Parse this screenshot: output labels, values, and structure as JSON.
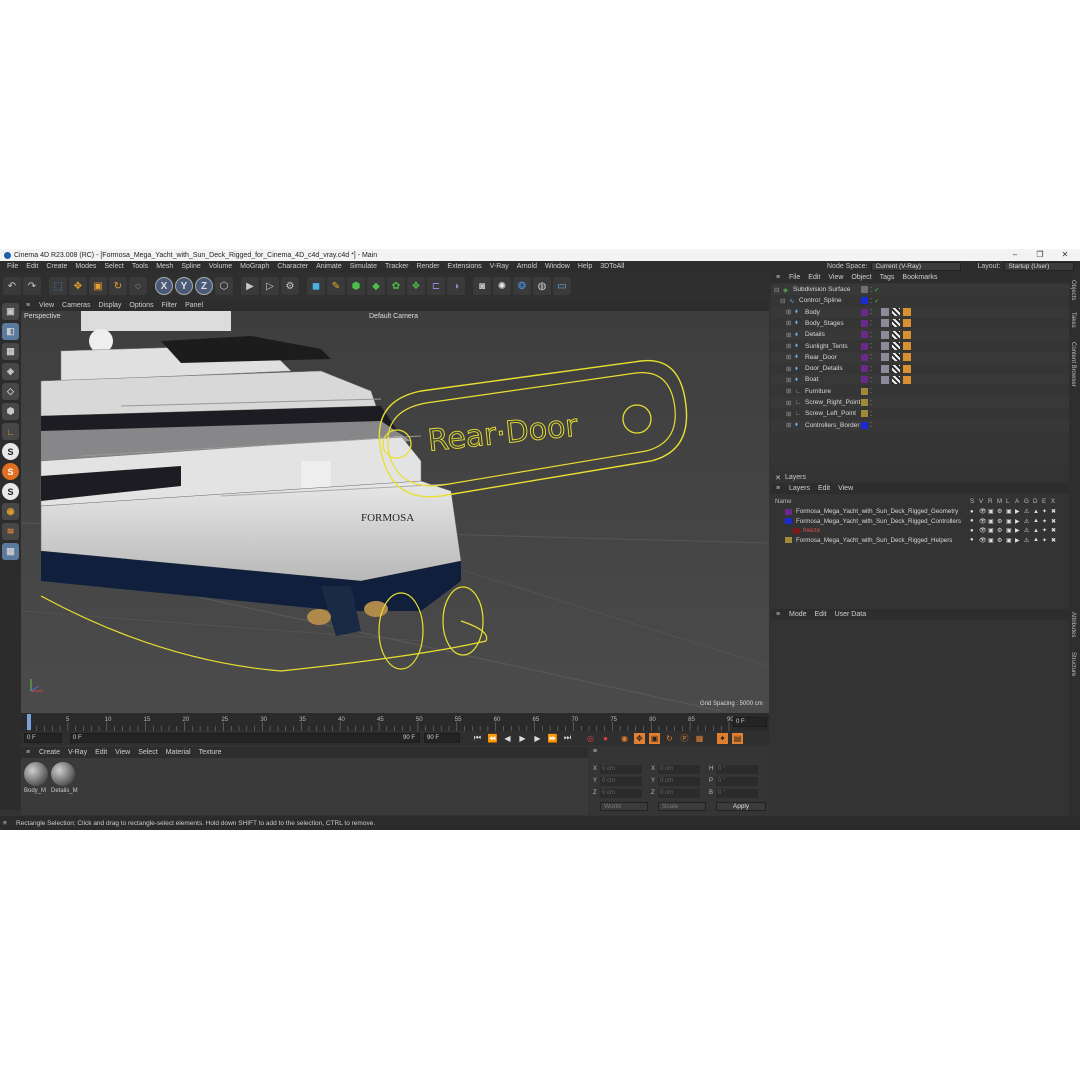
{
  "window": {
    "title": "Cinema 4D R23.008 (RC) - [Formosa_Mega_Yacht_with_Sun_Deck_Rigged_for_Cinema_4D_c4d_vray.c4d *] - Main",
    "minimize": "–",
    "maximize": "❐",
    "close": "✕"
  },
  "menubar": [
    "File",
    "Edit",
    "Create",
    "Modes",
    "Select",
    "Tools",
    "Mesh",
    "Spline",
    "Volume",
    "MoGraph",
    "Character",
    "Animate",
    "Simulate",
    "Tracker",
    "Render",
    "Extensions",
    "V-Ray",
    "Arnold",
    "Window",
    "Help",
    "3DToAll"
  ],
  "node_space": {
    "label": "Node Space:",
    "value": "Current (V-Ray)"
  },
  "layout": {
    "label": "Layout:",
    "value": "Startup (User)"
  },
  "toolbar_icons": [
    "undo-icon",
    "redo-icon",
    "live-selection-icon",
    "move-icon",
    "scale-icon",
    "rotate-icon",
    "recent-tool-icon",
    "x-axis-icon",
    "y-axis-icon",
    "z-axis-icon",
    "coordinate-system-icon",
    "render-view-icon",
    "render-picture-viewer-icon",
    "render-settings-icon",
    "cube-icon",
    "pen-icon",
    "subdivision-icon",
    "extrude-icon",
    "cloner-icon",
    "mograph-icon",
    "deformer-icon",
    "field-icon",
    "camera-icon",
    "light-icon",
    "python-icon",
    "sky-icon",
    "floor-icon"
  ],
  "toolbar_axes": [
    "X",
    "Y",
    "Z"
  ],
  "viewport": {
    "menu": [
      "View",
      "Cameras",
      "Display",
      "Options",
      "Filter",
      "Panel"
    ],
    "projection": "Perspective",
    "camera": "Default Camera",
    "grid_spacing": "Grid Spacing : 5000 cm",
    "controller_label": "Rear·Door",
    "yacht_name": "FORMOSA"
  },
  "timeline": {
    "ticks": [
      "0",
      "5",
      "10",
      "15",
      "20",
      "25",
      "30",
      "35",
      "40",
      "45",
      "50",
      "55",
      "60",
      "65",
      "70",
      "75",
      "80",
      "85",
      "90"
    ],
    "current_frame": "0 F"
  },
  "transport": {
    "start": "0 F",
    "range_start": "0 F",
    "range_end": "90 F",
    "end": "90 F"
  },
  "material_manager": {
    "menu": [
      "Create",
      "V-Ray",
      "Edit",
      "View",
      "Select",
      "Material",
      "Texture"
    ],
    "materials": [
      "Body_M",
      "Details_M"
    ]
  },
  "coordinates": {
    "rows": [
      {
        "a": "X",
        "av": "0 cm",
        "b": "X",
        "bv": "0 cm",
        "c": "H",
        "cv": "0 °"
      },
      {
        "a": "Y",
        "av": "0 cm",
        "b": "Y",
        "bv": "0 cm",
        "c": "P",
        "cv": "0 °"
      },
      {
        "a": "Z",
        "av": "0 cm",
        "b": "Z",
        "bv": "0 cm",
        "c": "B",
        "cv": "0 °"
      }
    ],
    "mode1": "World",
    "mode2": "Scale",
    "apply": "Apply"
  },
  "object_manager": {
    "menu": [
      "File",
      "Edit",
      "View",
      "Object",
      "Tags",
      "Bookmarks"
    ],
    "objects": [
      {
        "name": "Subdivision Surface",
        "indent": 0,
        "color": "#707070"
      },
      {
        "name": "Control_Spline",
        "indent": 1,
        "color": "#1a2ad4"
      },
      {
        "name": "Body",
        "indent": 2,
        "color": "#6a2a8a"
      },
      {
        "name": "Body_Stages",
        "indent": 2,
        "color": "#6a2a8a"
      },
      {
        "name": "Details",
        "indent": 2,
        "color": "#6a2a8a"
      },
      {
        "name": "Sunlight_Tents",
        "indent": 2,
        "color": "#6a2a8a"
      },
      {
        "name": "Rear_Door",
        "indent": 2,
        "color": "#6a2a8a"
      },
      {
        "name": "Door_Details",
        "indent": 2,
        "color": "#6a2a8a"
      },
      {
        "name": "Boat",
        "indent": 2,
        "color": "#6a2a8a"
      },
      {
        "name": "Furniture",
        "indent": 2,
        "color": "#a08a3a"
      },
      {
        "name": "Screw_Right_Point",
        "indent": 2,
        "color": "#a08a3a"
      },
      {
        "name": "Screw_Left_Point",
        "indent": 2,
        "color": "#a08a3a"
      },
      {
        "name": "Controllers_Border",
        "indent": 2,
        "color": "#1a2ad4"
      }
    ]
  },
  "layer_manager": {
    "title": "Layers",
    "menu": [
      "Layers",
      "Edit",
      "View"
    ],
    "columns": [
      "Name",
      "S",
      "V",
      "R",
      "M",
      "L",
      "A",
      "G",
      "D",
      "E",
      "X"
    ],
    "layers": [
      {
        "name": "Formosa_Mega_Yacht_with_Sun_Deck_Rigged_Geometry",
        "color": "#6a2a8a"
      },
      {
        "name": "Formosa_Mega_Yacht_with_Sun_Deck_Rigged_Controllers",
        "color": "#1a2ad4"
      },
      {
        "name": "freeze",
        "color": "#7a1a1a"
      },
      {
        "name": "Formosa_Mega_Yacht_with_Sun_Deck_Rigged_Helpers",
        "color": "#a08a3a"
      }
    ]
  },
  "attributes": {
    "menu": [
      "Mode",
      "Edit",
      "User Data"
    ]
  },
  "side_tabs": [
    "Objects",
    "Takes",
    "Content Browser",
    "Attributes",
    "Structure"
  ],
  "status": "Rectangle Selection: Click and drag to rectangle-select elements. Hold down SHIFT to add to the selection, CTRL to remove."
}
